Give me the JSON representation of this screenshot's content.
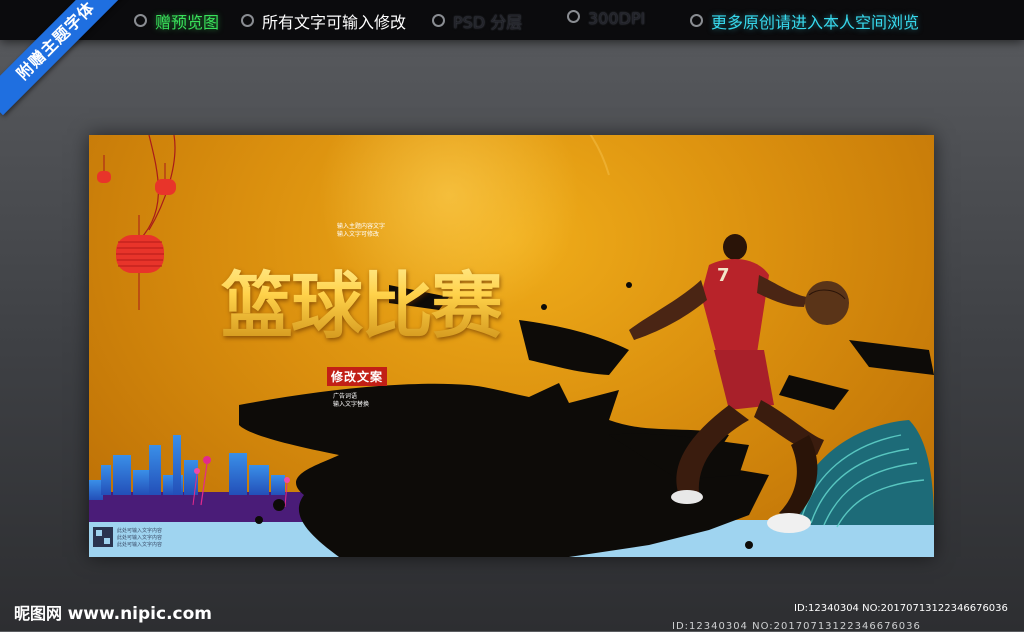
{
  "topbar": {
    "items": [
      {
        "label": "赠预览图",
        "style": "green"
      },
      {
        "label": "所有文字可输入修改",
        "style": "white"
      },
      {
        "label": "PSD 分层",
        "style": "dim"
      },
      {
        "label": "300DPI",
        "style": "dim"
      },
      {
        "label": "更多原创请进入本人空间浏览",
        "style": "cyan"
      }
    ]
  },
  "ribbon": {
    "label": "附赠主题字体"
  },
  "poster": {
    "headline": "篮球比赛",
    "tagline": "修改文案",
    "small_text_top": [
      "输入主题内容文字",
      "输入文字可修改"
    ],
    "small_text_mid": [
      "广告词语",
      "输入文字替换"
    ],
    "qr_text": [
      "此处可输入文字内容",
      "此处可输入文字内容",
      "此处可输入文字内容"
    ],
    "jersey_number": "7"
  },
  "watermark": {
    "brand": "昵图网",
    "site": "www.nipic.com",
    "id": "ID:12340304 NO:20170713122346676036",
    "id_partial": "ID:12340304 NO:20170713122346676036"
  },
  "colors": {
    "ribbon": "#1f6fe0",
    "poster_bg": "#da8f0e",
    "tagline_bg": "#c21f16",
    "accent_green": "#39e05a",
    "accent_cyan": "#37d8ec"
  }
}
